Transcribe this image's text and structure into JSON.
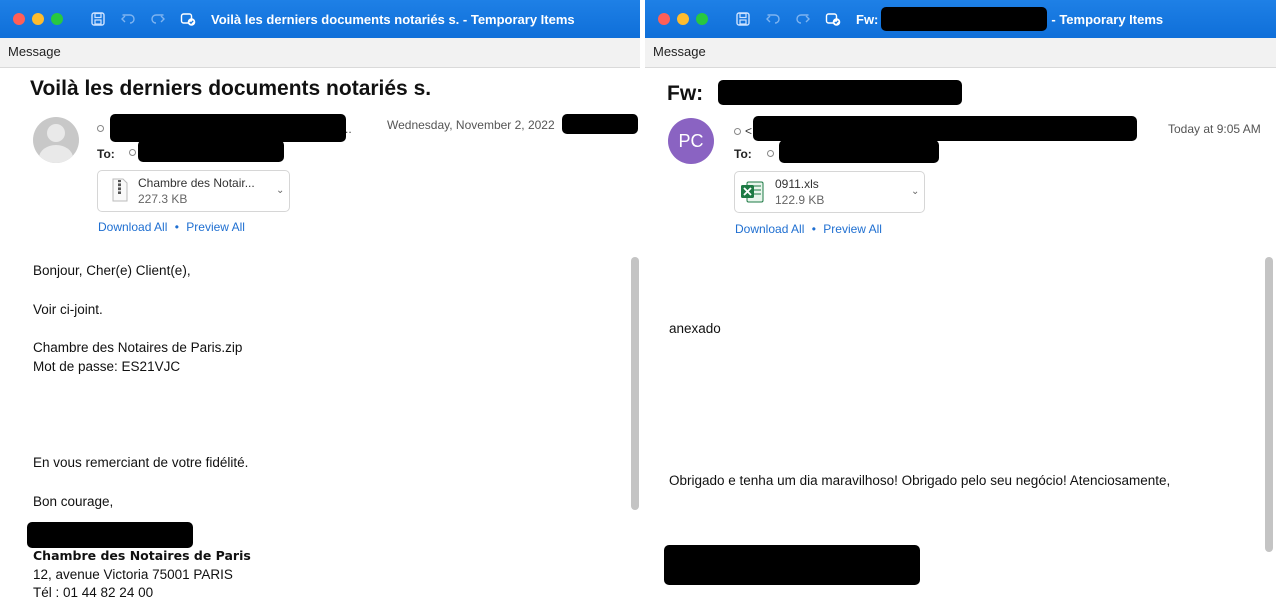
{
  "window1": {
    "title": "Voilà les derniers documents notariés s. - Temporary Items",
    "ribbon_tab": "Message",
    "subject": "Voilà les derniers documents notariés s.",
    "sender_suffix": "..",
    "to_label": "To:",
    "date": "Wednesday, November 2, 2022",
    "attachment": {
      "name": "Chambre des Notair...",
      "size": "227.3 KB",
      "icon": "zip-file-icon"
    },
    "download_all": "Download All",
    "separator": "•",
    "preview_all": "Preview All",
    "body": {
      "greeting": "Bonjour, Cher(e) Client(e),",
      "line1": "Voir ci-joint.",
      "line2": "Chambre des Notaires de Paris.zip",
      "line3": "Mot de passe: ES21VJC",
      "line4": "En vous remerciant de votre fidélité.",
      "line5": "Bon courage,",
      "sig_org": "Chambre des Notaires de Paris",
      "sig_addr": "12, avenue Victoria 75001 PARIS",
      "sig_tel": "Tél : 01 44 82 24 00"
    }
  },
  "window2": {
    "title_prefix": "Fw:",
    "title_suffix": "- Temporary Items",
    "ribbon_tab": "Message",
    "subject_prefix": "Fw:",
    "avatar_initials": "PC",
    "sender_prefix": "<",
    "to_label": "To:",
    "date": "Today at 9:05 AM",
    "attachment": {
      "name": "0911.xls",
      "size": "122.9 KB",
      "icon": "excel-file-icon"
    },
    "download_all": "Download All",
    "separator": "•",
    "preview_all": "Preview All",
    "body": {
      "line1": "anexado",
      "line2": "Obrigado e tenha um dia maravilhoso! Obrigado pelo seu negócio! Atenciosamente,"
    }
  },
  "colors": {
    "titlebar": "#1578e0",
    "link": "#1f6fd1",
    "avatar_pc": "#8a63c2"
  }
}
